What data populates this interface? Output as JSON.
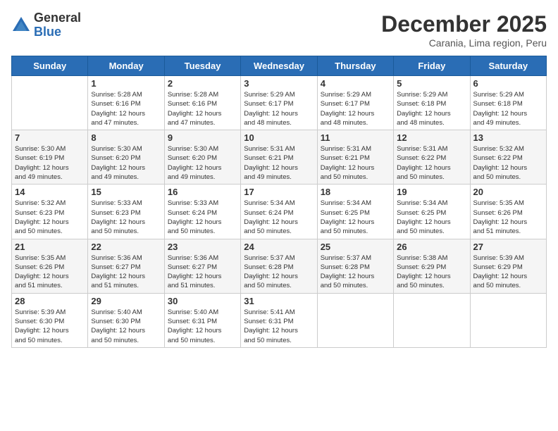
{
  "header": {
    "logo_general": "General",
    "logo_blue": "Blue",
    "month_title": "December 2025",
    "location": "Carania, Lima region, Peru"
  },
  "weekdays": [
    "Sunday",
    "Monday",
    "Tuesday",
    "Wednesday",
    "Thursday",
    "Friday",
    "Saturday"
  ],
  "rows": [
    {
      "shade": "white",
      "cells": [
        {
          "day": "",
          "info": ""
        },
        {
          "day": "1",
          "info": "Sunrise: 5:28 AM\nSunset: 6:16 PM\nDaylight: 12 hours\nand 47 minutes."
        },
        {
          "day": "2",
          "info": "Sunrise: 5:28 AM\nSunset: 6:16 PM\nDaylight: 12 hours\nand 47 minutes."
        },
        {
          "day": "3",
          "info": "Sunrise: 5:29 AM\nSunset: 6:17 PM\nDaylight: 12 hours\nand 48 minutes."
        },
        {
          "day": "4",
          "info": "Sunrise: 5:29 AM\nSunset: 6:17 PM\nDaylight: 12 hours\nand 48 minutes."
        },
        {
          "day": "5",
          "info": "Sunrise: 5:29 AM\nSunset: 6:18 PM\nDaylight: 12 hours\nand 48 minutes."
        },
        {
          "day": "6",
          "info": "Sunrise: 5:29 AM\nSunset: 6:18 PM\nDaylight: 12 hours\nand 49 minutes."
        }
      ]
    },
    {
      "shade": "shaded",
      "cells": [
        {
          "day": "7",
          "info": "Sunrise: 5:30 AM\nSunset: 6:19 PM\nDaylight: 12 hours\nand 49 minutes."
        },
        {
          "day": "8",
          "info": "Sunrise: 5:30 AM\nSunset: 6:20 PM\nDaylight: 12 hours\nand 49 minutes."
        },
        {
          "day": "9",
          "info": "Sunrise: 5:30 AM\nSunset: 6:20 PM\nDaylight: 12 hours\nand 49 minutes."
        },
        {
          "day": "10",
          "info": "Sunrise: 5:31 AM\nSunset: 6:21 PM\nDaylight: 12 hours\nand 49 minutes."
        },
        {
          "day": "11",
          "info": "Sunrise: 5:31 AM\nSunset: 6:21 PM\nDaylight: 12 hours\nand 50 minutes."
        },
        {
          "day": "12",
          "info": "Sunrise: 5:31 AM\nSunset: 6:22 PM\nDaylight: 12 hours\nand 50 minutes."
        },
        {
          "day": "13",
          "info": "Sunrise: 5:32 AM\nSunset: 6:22 PM\nDaylight: 12 hours\nand 50 minutes."
        }
      ]
    },
    {
      "shade": "white",
      "cells": [
        {
          "day": "14",
          "info": "Sunrise: 5:32 AM\nSunset: 6:23 PM\nDaylight: 12 hours\nand 50 minutes."
        },
        {
          "day": "15",
          "info": "Sunrise: 5:33 AM\nSunset: 6:23 PM\nDaylight: 12 hours\nand 50 minutes."
        },
        {
          "day": "16",
          "info": "Sunrise: 5:33 AM\nSunset: 6:24 PM\nDaylight: 12 hours\nand 50 minutes."
        },
        {
          "day": "17",
          "info": "Sunrise: 5:34 AM\nSunset: 6:24 PM\nDaylight: 12 hours\nand 50 minutes."
        },
        {
          "day": "18",
          "info": "Sunrise: 5:34 AM\nSunset: 6:25 PM\nDaylight: 12 hours\nand 50 minutes."
        },
        {
          "day": "19",
          "info": "Sunrise: 5:34 AM\nSunset: 6:25 PM\nDaylight: 12 hours\nand 50 minutes."
        },
        {
          "day": "20",
          "info": "Sunrise: 5:35 AM\nSunset: 6:26 PM\nDaylight: 12 hours\nand 51 minutes."
        }
      ]
    },
    {
      "shade": "shaded",
      "cells": [
        {
          "day": "21",
          "info": "Sunrise: 5:35 AM\nSunset: 6:26 PM\nDaylight: 12 hours\nand 51 minutes."
        },
        {
          "day": "22",
          "info": "Sunrise: 5:36 AM\nSunset: 6:27 PM\nDaylight: 12 hours\nand 51 minutes."
        },
        {
          "day": "23",
          "info": "Sunrise: 5:36 AM\nSunset: 6:27 PM\nDaylight: 12 hours\nand 51 minutes."
        },
        {
          "day": "24",
          "info": "Sunrise: 5:37 AM\nSunset: 6:28 PM\nDaylight: 12 hours\nand 50 minutes."
        },
        {
          "day": "25",
          "info": "Sunrise: 5:37 AM\nSunset: 6:28 PM\nDaylight: 12 hours\nand 50 minutes."
        },
        {
          "day": "26",
          "info": "Sunrise: 5:38 AM\nSunset: 6:29 PM\nDaylight: 12 hours\nand 50 minutes."
        },
        {
          "day": "27",
          "info": "Sunrise: 5:39 AM\nSunset: 6:29 PM\nDaylight: 12 hours\nand 50 minutes."
        }
      ]
    },
    {
      "shade": "white",
      "cells": [
        {
          "day": "28",
          "info": "Sunrise: 5:39 AM\nSunset: 6:30 PM\nDaylight: 12 hours\nand 50 minutes."
        },
        {
          "day": "29",
          "info": "Sunrise: 5:40 AM\nSunset: 6:30 PM\nDaylight: 12 hours\nand 50 minutes."
        },
        {
          "day": "30",
          "info": "Sunrise: 5:40 AM\nSunset: 6:31 PM\nDaylight: 12 hours\nand 50 minutes."
        },
        {
          "day": "31",
          "info": "Sunrise: 5:41 AM\nSunset: 6:31 PM\nDaylight: 12 hours\nand 50 minutes."
        },
        {
          "day": "",
          "info": ""
        },
        {
          "day": "",
          "info": ""
        },
        {
          "day": "",
          "info": ""
        }
      ]
    }
  ]
}
